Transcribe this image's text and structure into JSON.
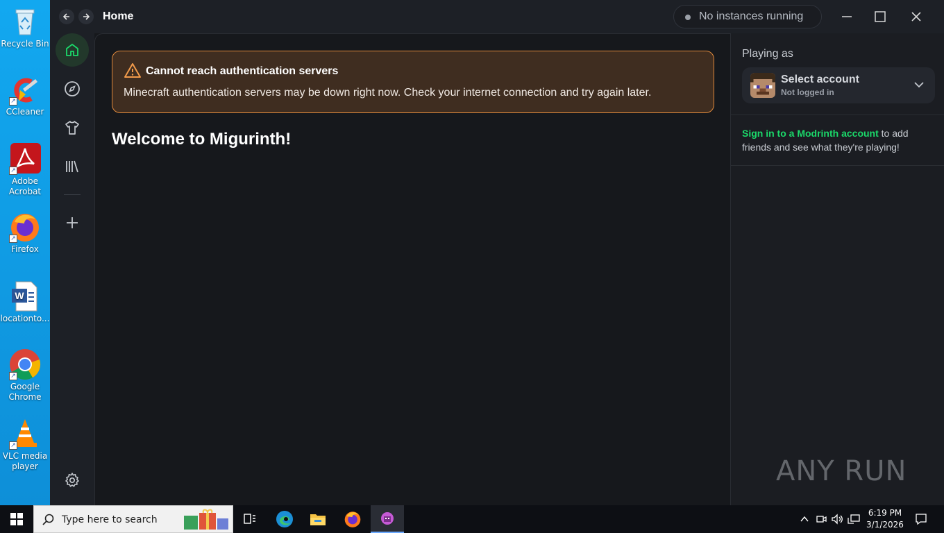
{
  "desktop": {
    "icons": [
      {
        "label": "Recycle Bin"
      },
      {
        "label": "CCleaner"
      },
      {
        "label": "Adobe Acrobat"
      },
      {
        "label": "Firefox"
      },
      {
        "label": "locationto..."
      },
      {
        "label": "Google Chrome"
      },
      {
        "label": "VLC media player"
      }
    ]
  },
  "app": {
    "page_title": "Home",
    "instances_status": "No instances running",
    "sidebar": {
      "items": [
        {
          "icon": "home-icon",
          "active": true
        },
        {
          "icon": "compass-icon"
        },
        {
          "icon": "skins-icon"
        },
        {
          "icon": "library-icon"
        },
        {
          "icon": "plus-icon"
        },
        {
          "icon": "gear-icon"
        }
      ]
    },
    "alert": {
      "title": "Cannot reach authentication servers",
      "body": "Minecraft authentication servers may be down right now. Check your internet connection and try again later."
    },
    "welcome": "Welcome to Migurinth!",
    "right_panel": {
      "playing_as": "Playing as",
      "account_name": "Select account",
      "account_status": "Not logged in",
      "signin_link": "Sign in to a Modrinth account",
      "signin_rest": " to add friends and see what they're playing!"
    },
    "accent_color": "#1bd96a",
    "warning_color": "#e08a3c"
  },
  "watermark": "ANY RUN",
  "taskbar": {
    "search_placeholder": "Type here to search",
    "time": "6:19 PM",
    "date": "3/1/2026"
  }
}
